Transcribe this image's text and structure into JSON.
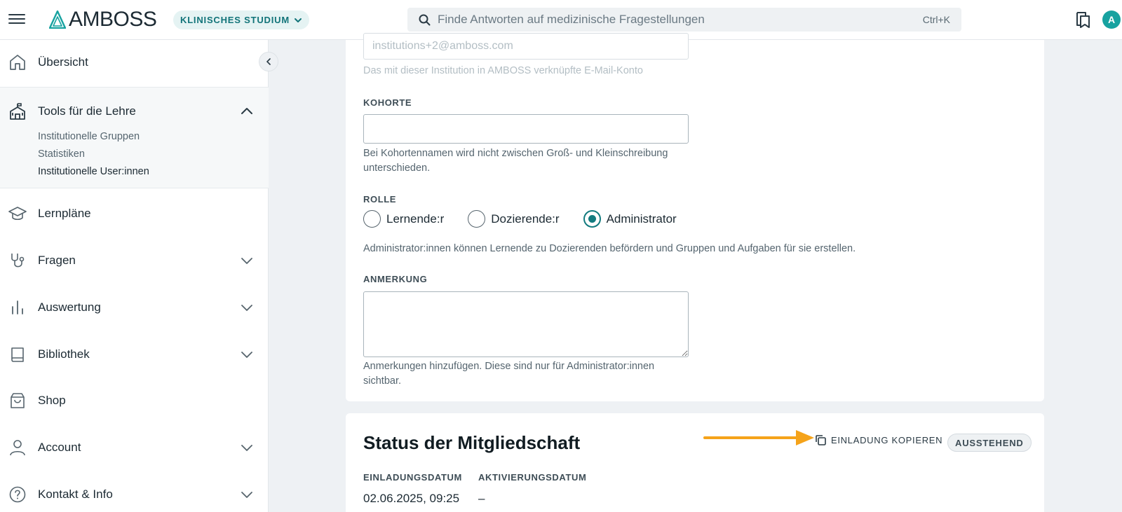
{
  "header": {
    "logo_text": "AMBOSS",
    "study_mode": "KLINISCHES STUDIUM",
    "search_placeholder": "Finde Antworten auf medizinische Fragestellungen",
    "search_shortcut": "Ctrl+K",
    "avatar_initial": "A"
  },
  "sidebar": {
    "overview": "Übersicht",
    "tools": {
      "label": "Tools für die Lehre",
      "subitems": [
        "Institutionelle Gruppen",
        "Statistiken",
        "Institutionelle User:innen"
      ],
      "active_subitem": "Institutionelle User:innen"
    },
    "items": [
      {
        "label": "Lernpläne",
        "icon": "graduation-cap-icon",
        "expandable": false
      },
      {
        "label": "Fragen",
        "icon": "stethoscope-icon",
        "expandable": true
      },
      {
        "label": "Auswertung",
        "icon": "bar-chart-icon",
        "expandable": true
      },
      {
        "label": "Bibliothek",
        "icon": "book-icon",
        "expandable": true
      },
      {
        "label": "Shop",
        "icon": "shopping-bag-icon",
        "expandable": false
      },
      {
        "label": "Account",
        "icon": "user-icon",
        "expandable": true
      },
      {
        "label": "Kontakt & Info",
        "icon": "help-circle-icon",
        "expandable": true
      }
    ]
  },
  "form": {
    "email_value": "institutions+2@amboss.com",
    "email_help": "Das mit dieser Institution in AMBOSS verknüpfte E-Mail-Konto",
    "cohort_label": "KOHORTE",
    "cohort_value": "",
    "cohort_help": "Bei Kohortennamen wird nicht zwischen Groß- und Kleinschreibung unterschieden.",
    "role_label": "ROLLE",
    "roles": [
      "Lernende:r",
      "Dozierende:r",
      "Administrator"
    ],
    "selected_role": "Administrator",
    "role_help": "Administrator:innen können Lernende zu Dozierenden befördern und Gruppen und Aufgaben für sie erstellen.",
    "note_label": "ANMERKUNG",
    "note_value": "",
    "note_help": "Anmerkungen hinzufügen. Diese sind nur für Administrator:innen sichtbar."
  },
  "membership": {
    "title": "Status der Mitgliedschaft",
    "copy_invite_label": "EINLADUNG KOPIEREN",
    "status_badge": "AUSSTEHEND",
    "invite_date_label": "EINLADUNGSDATUM",
    "invite_date_value": "02.06.2025, 09:25",
    "activation_date_label": "AKTIVIERUNGSDATUM",
    "activation_date_value": "–"
  },
  "colors": {
    "brand_teal": "#137b7f",
    "arrow_orange": "#f5a31a",
    "avatar_bg": "#17a2a0"
  }
}
